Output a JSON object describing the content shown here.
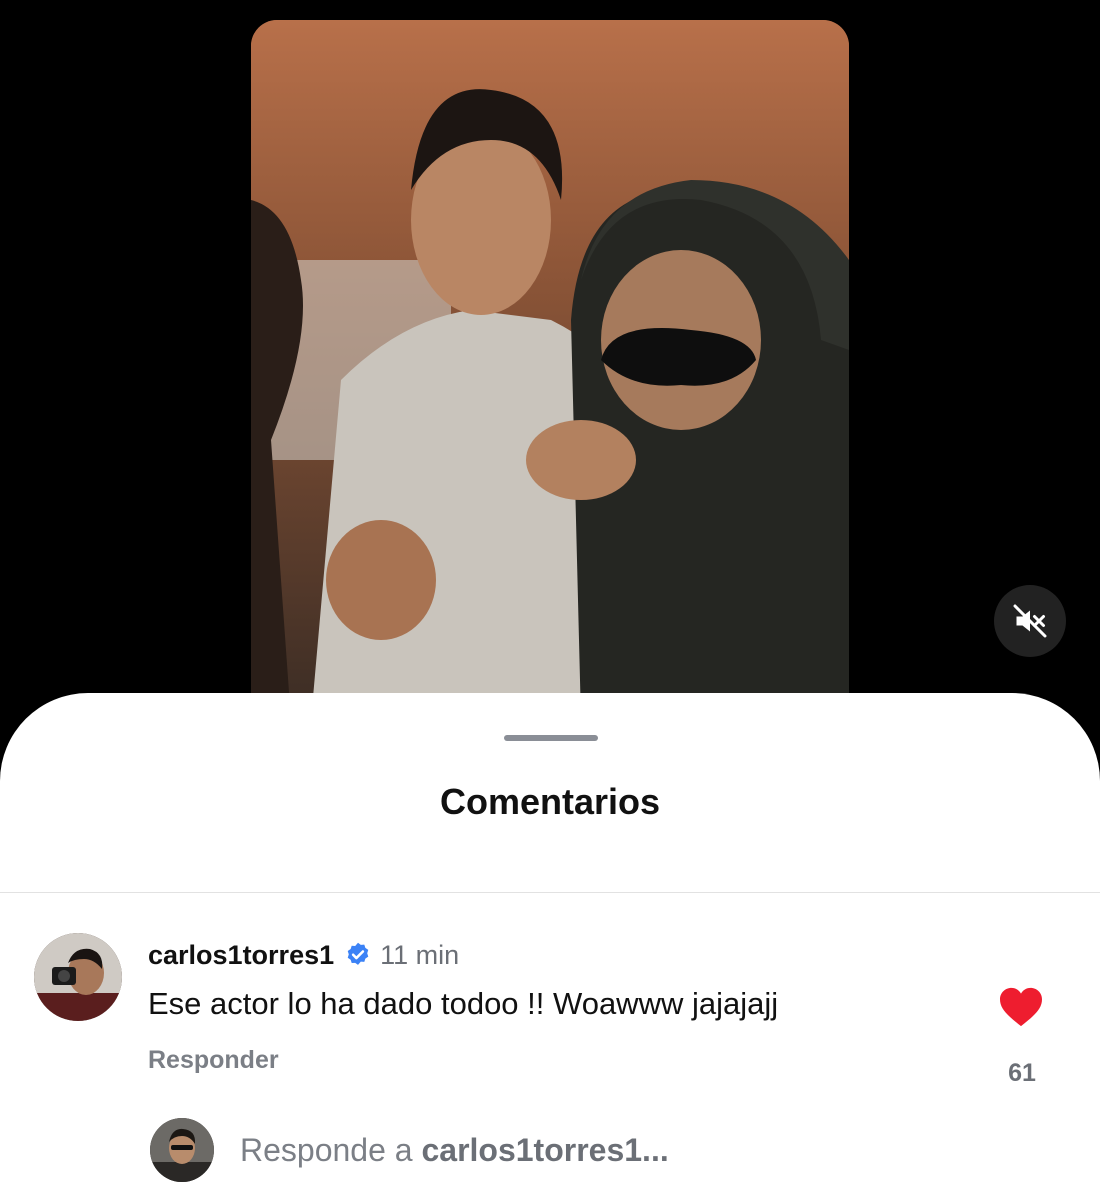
{
  "video": {
    "muted": true,
    "icons": {
      "mute": "speaker-muted-icon"
    }
  },
  "sheet": {
    "title": "Comentarios"
  },
  "comment": {
    "username": "carlos1torres1",
    "verified": true,
    "time": "11 min",
    "text": "Ese actor lo ha dado todoo !! Woawww jajajajj",
    "reply_label": "Responder",
    "likes": "61",
    "liked": true,
    "colors": {
      "heart": "#ee1d2f",
      "verified": "#3b82f6"
    }
  },
  "reply_bar": {
    "prefix": "Responde a",
    "target": "carlos1torres1..."
  }
}
